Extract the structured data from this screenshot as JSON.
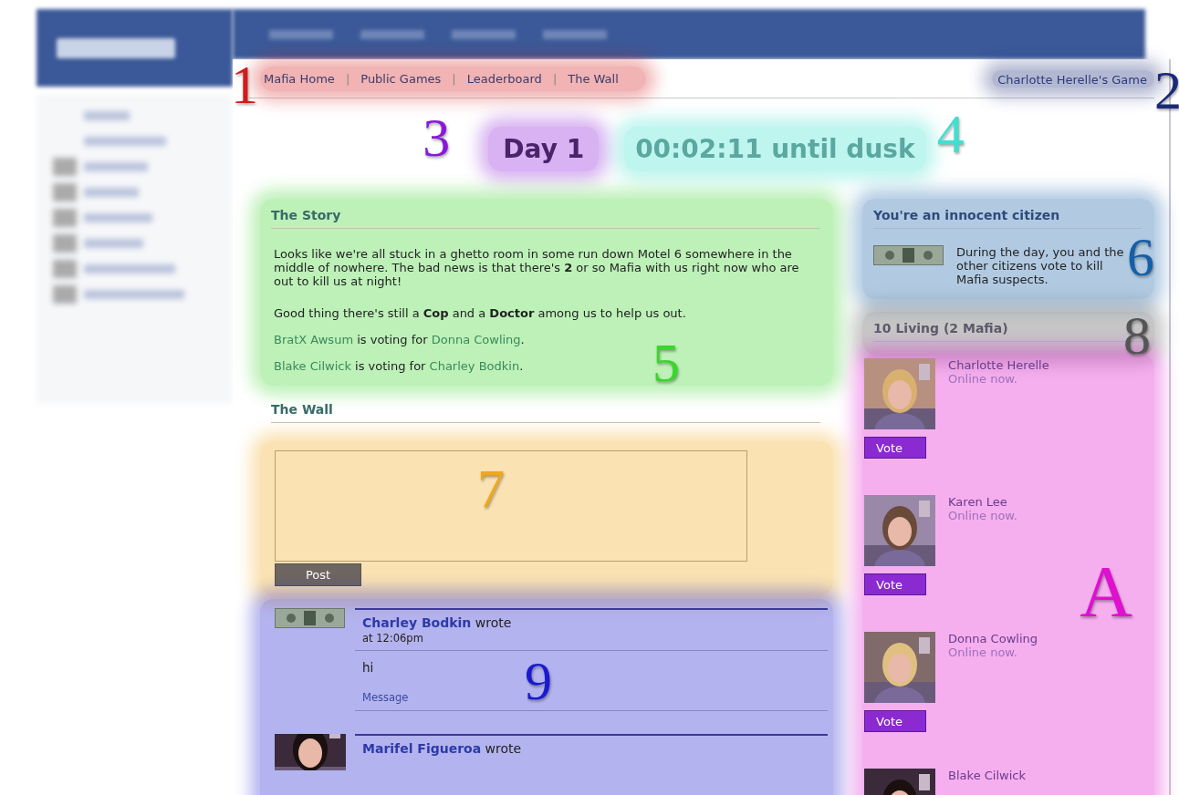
{
  "nav": {
    "links": {
      "items": [
        "Mafia Home",
        "Public Games",
        "Leaderboard",
        "The Wall"
      ],
      "separator": "|",
      "callout": {
        "text": "1",
        "color": "#d41a1a"
      }
    },
    "game_link": {
      "label": "Charlotte Herelle's Game",
      "callout": {
        "text": "2",
        "color": "#1b2a78"
      }
    }
  },
  "status": {
    "day": {
      "text": "Day 1",
      "callout": {
        "text": "3",
        "color": "#8a18d8"
      }
    },
    "timer": {
      "text": "00:02:11 until dusk",
      "callout": {
        "text": "4",
        "color": "#3fe0d0"
      }
    }
  },
  "story": {
    "title": "The Story",
    "callout": {
      "text": "5",
      "color": "#3ad62a"
    },
    "paragraphs": [
      "Looks like we're all stuck in a ghetto room in some run down Motel 6 somewhere in the middle of nowhere. The bad news is that there's **2** or so Mafia with us right now who are out to kill us at night!",
      "Good thing there's still a **Cop** and a **Doctor** among us to help us out."
    ],
    "votes": [
      {
        "voter": "BratX Awsum",
        "middle": " is voting for ",
        "target": "Donna Cowling",
        "end": "."
      },
      {
        "voter": "Blake Cilwick",
        "middle": " is voting for ",
        "target": "Charley Bodkin",
        "end": "."
      }
    ]
  },
  "wall": {
    "title": "The Wall",
    "composer_callout": {
      "text": "7",
      "color": "#f0a818"
    },
    "post_button": "Post",
    "posts_callout": {
      "text": "9",
      "color": "#1a1ad0"
    },
    "posts": [
      {
        "kind": "money",
        "author": "Charley Bodkin",
        "verb": " wrote",
        "time": "at 12:06pm",
        "body": "hi",
        "action": "Message"
      },
      {
        "kind": "picture",
        "author": "Marifel Figueroa",
        "verb": " wrote"
      }
    ]
  },
  "role": {
    "title": "You're an innocent citizen",
    "text": "During the day, you and the other citizens vote to kill Mafia suspects.",
    "callout": {
      "text": "6",
      "color": "#1560a8"
    }
  },
  "living": {
    "title": "10 Living (2 Mafia)",
    "callout": {
      "text": "8",
      "color": "#555555"
    }
  },
  "players": {
    "callout": {
      "text": "A",
      "color": "#e010d0"
    },
    "items": [
      {
        "name": "Charlotte Herelle",
        "status": "Online now.",
        "vote": "Vote"
      },
      {
        "name": "Karen Lee",
        "status": "Online now.",
        "vote": "Vote"
      },
      {
        "name": "Donna Cowling",
        "status": "Online now.",
        "vote": "Vote"
      },
      {
        "name": "Blake Cilwick"
      }
    ]
  }
}
